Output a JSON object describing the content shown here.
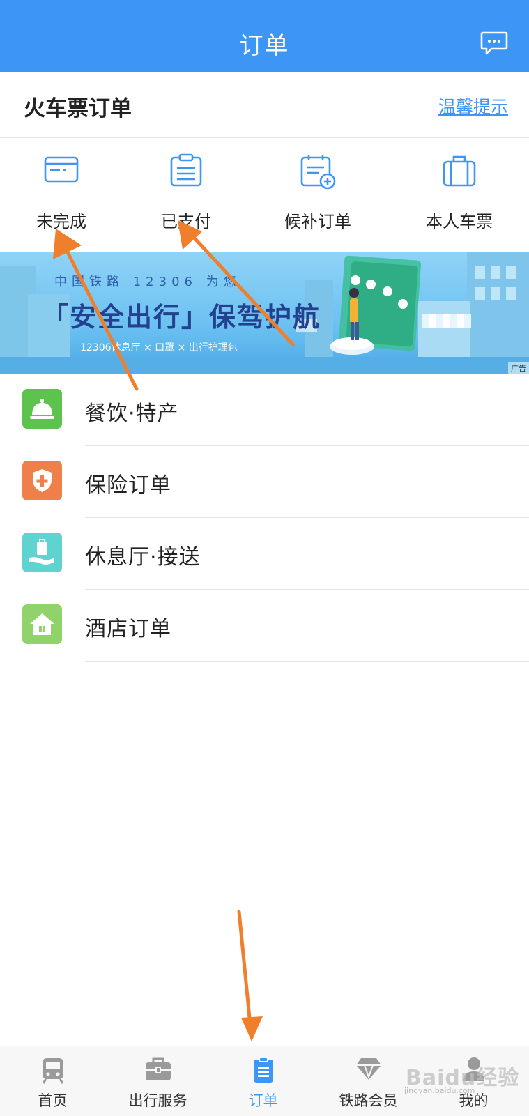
{
  "header": {
    "title": "订单",
    "message_icon": "chat-bubble-icon"
  },
  "section": {
    "title": "火车票订单",
    "tips_link": "温馨提示"
  },
  "quick_actions": [
    {
      "label": "未完成",
      "icon": "card-icon"
    },
    {
      "label": "已支付",
      "icon": "clipboard-icon"
    },
    {
      "label": "候补订单",
      "icon": "calendar-add-icon"
    },
    {
      "label": "本人车票",
      "icon": "luggage-icon"
    }
  ],
  "banner": {
    "small_text": "中国铁路 12306 为您",
    "main_text": "「安全出行」保驾护航",
    "sub_text": "12306休息厅 × 口罩 × 出行护理包",
    "ad_tag": "广告"
  },
  "list": [
    {
      "label": "餐饮·特产",
      "icon": "service-bell-icon",
      "color": "#5cc44d"
    },
    {
      "label": "保险订单",
      "icon": "shield-plus-icon",
      "color": "#f0804a"
    },
    {
      "label": "休息厅·接送",
      "icon": "hand-luggage-icon",
      "color": "#5ed3d0"
    },
    {
      "label": "酒店订单",
      "icon": "house-icon",
      "color": "#8fd36a"
    }
  ],
  "tabbar": [
    {
      "label": "首页",
      "icon": "train-icon",
      "active": false
    },
    {
      "label": "出行服务",
      "icon": "briefcase-icon",
      "active": false
    },
    {
      "label": "订单",
      "icon": "order-list-icon",
      "active": true
    },
    {
      "label": "铁路会员",
      "icon": "diamond-icon",
      "active": false
    },
    {
      "label": "我的",
      "icon": "person-icon",
      "active": false
    }
  ],
  "watermark": {
    "text": "Baidu经验",
    "sub": "jingyan.baidu.com"
  },
  "colors": {
    "primary": "#3d96f5",
    "annotation_arrow": "#f07f2b"
  }
}
